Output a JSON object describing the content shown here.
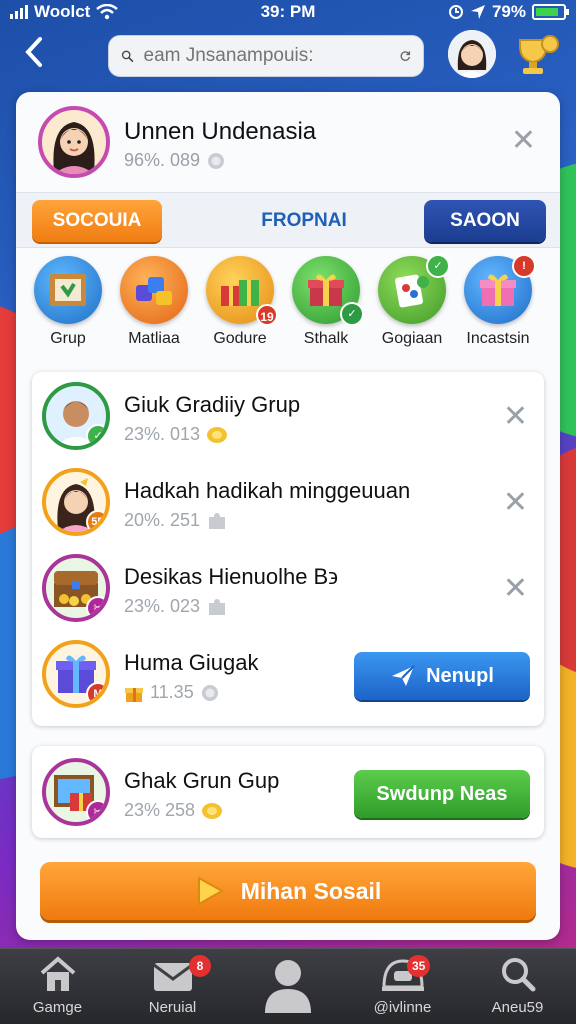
{
  "status_bar": {
    "carrier": "Woolct",
    "time": "39: PM",
    "battery": "79%"
  },
  "topbar": {
    "search_placeholder": "eam Jnsanampouis:"
  },
  "profile": {
    "name": "Unnen Undenasia",
    "meta": "96%. 089"
  },
  "tabs": [
    {
      "label": "SOCOUIA",
      "style": "orange"
    },
    {
      "label": "FROPNAI",
      "style": "plain"
    },
    {
      "label": "SAOON",
      "style": "navy"
    }
  ],
  "categories": [
    {
      "label": "Grup",
      "icon": "picture-frame-icon",
      "color": "#2b86d6",
      "badge": ""
    },
    {
      "label": "Matliaa",
      "icon": "blocks-icon",
      "color": "#f07a1c",
      "badge": ""
    },
    {
      "label": "Godure",
      "icon": "gift-boxes-icon",
      "color": "#f2a21a",
      "badge": "19"
    },
    {
      "label": "Sthalk",
      "icon": "gift-box-icon",
      "color": "#3fb24a",
      "badge": ""
    },
    {
      "label": "Gogiaan",
      "icon": "cards-icon",
      "color": "#58b83a",
      "badge": ""
    },
    {
      "label": "Incastsin",
      "icon": "present-icon",
      "color": "#2f8ee0",
      "badge": ""
    }
  ],
  "list": [
    {
      "title": "Giuk Gradiiy Grup",
      "meta": "23%. 013",
      "ring": "#2e9a44",
      "kind": "person-boy",
      "badge_color": "#3fb24a",
      "action": "close"
    },
    {
      "title": "Hadkah hadikah minggeuuan",
      "meta": "20%. 251",
      "ring": "#f2a21a",
      "kind": "person-girl",
      "badge_color": "#e67a12",
      "badge_text": "5E",
      "action": "close"
    },
    {
      "title": "Desikas Hienuolhe B϶",
      "meta": "23%. 023",
      "ring": "#a9349a",
      "kind": "treasure",
      "badge_color": "#b0279a",
      "action": "close"
    },
    {
      "title": "Huma Giugak",
      "meta": "11.35",
      "ring": "#f2a21a",
      "kind": "giftbox",
      "badge_color": "#d83a2a",
      "badge_text": "M",
      "action": "button",
      "button_label": "Nenupl"
    }
  ],
  "single": {
    "title": "Ghak Grun Gup",
    "meta": "23% 258",
    "button_label": "Swdunp Neas"
  },
  "cta_label": "Mihan Sosail",
  "nav": [
    {
      "label": "Gamge",
      "icon": "home-icon",
      "badge": ""
    },
    {
      "label": "Neruial",
      "icon": "mail-icon",
      "badge": "8"
    },
    {
      "label": "",
      "icon": "profile-icon",
      "badge": ""
    },
    {
      "label": "@ivlinne",
      "icon": "helmet-icon",
      "badge": "35"
    },
    {
      "label": "Aneu59",
      "icon": "search-icon",
      "badge": ""
    }
  ]
}
